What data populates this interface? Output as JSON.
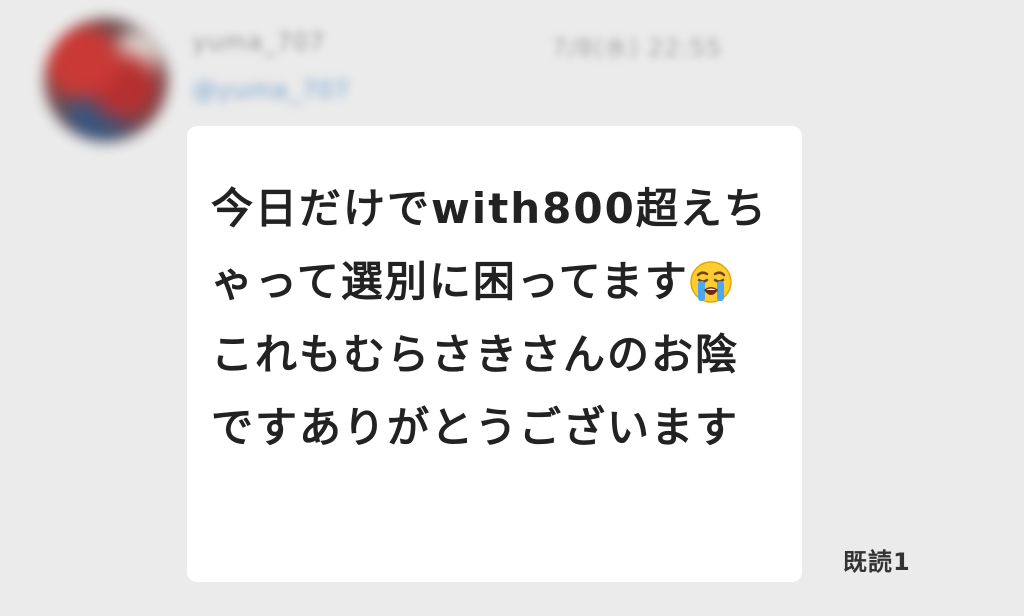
{
  "sender": {
    "name": "yuma_707",
    "timestamp": "7/8(水) 22:55",
    "handle": "@yuma_707"
  },
  "message": {
    "text_before_emoji": "今日だけでwith800超えちゃって選別に困ってます",
    "emoji": "loudly-crying-face-emoji",
    "text_after_emoji": "これもむらさきさんのお陰ですありがとうございます"
  },
  "read_receipt": "既読1",
  "colors": {
    "background": "#ebebeb",
    "bubble": "#ffffff",
    "text": "#222222"
  }
}
